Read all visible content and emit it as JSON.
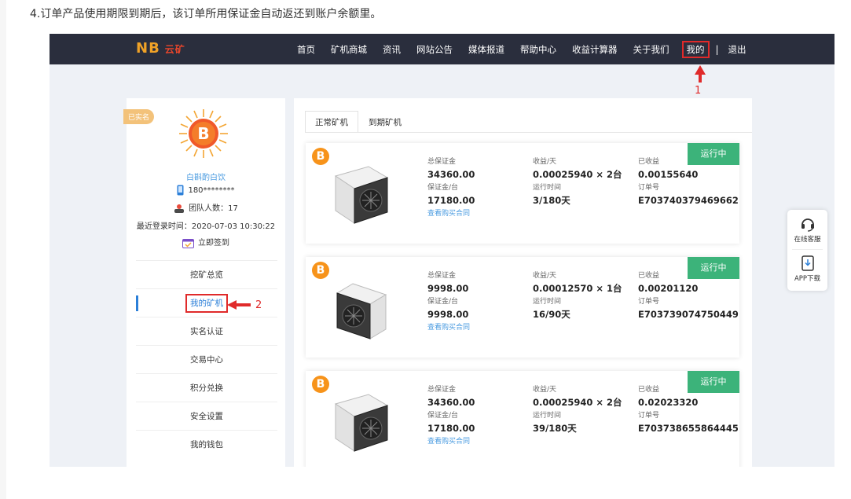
{
  "caption": "4.订单产品使用期限到期后，该订单所用保证金自动返还到账户余额里。",
  "nav": {
    "logo_main": "NB",
    "logo_sub": "云矿",
    "items": [
      "首页",
      "矿机商城",
      "资讯",
      "网站公告",
      "媒体报道",
      "帮助中心",
      "收益计算器",
      "关于我们",
      "我的"
    ],
    "separator": "|",
    "logout": "退出"
  },
  "annotations": {
    "marker1": "1",
    "marker2": "2",
    "arrow_color": "#e02a2a"
  },
  "profile": {
    "badge": "已实名",
    "name": "白斟酌白饮",
    "phone": "180********",
    "team": "团队人数：17",
    "last_login": "最近登录时间：2020-07-03 10:30:22",
    "checkin": "立即签到"
  },
  "menu": [
    "挖矿总览",
    "我的矿机",
    "实名认证",
    "交易中心",
    "积分兑换",
    "安全设置",
    "我的钱包"
  ],
  "menu_active_index": 1,
  "tabs": [
    "正常矿机",
    "到期矿机"
  ],
  "labels": {
    "total_deposit": "总保证金",
    "daily_income": "收益/天",
    "earned": "已收益",
    "deposit_per_unit": "保证金/台",
    "run_time": "运行时间",
    "order_no": "订单号",
    "contract_link": "查看购买合同"
  },
  "orders": [
    {
      "status": "运行中",
      "total_deposit": "34360.00",
      "daily_income": "0.00025940 × 2台",
      "earned": "0.00155640",
      "deposit_per_unit": "17180.00",
      "run_time": "3/180天",
      "order_no": "E703740379469662"
    },
    {
      "status": "运行中",
      "total_deposit": "9998.00",
      "daily_income": "0.00012570 × 1台",
      "earned": "0.00201120",
      "deposit_per_unit": "9998.00",
      "run_time": "16/90天",
      "order_no": "E703739074750449"
    },
    {
      "status": "运行中",
      "total_deposit": "34360.00",
      "daily_income": "0.00025940 × 2台",
      "earned": "0.02023320",
      "deposit_per_unit": "17180.00",
      "run_time": "39/180天",
      "order_no": "E703738655864445"
    }
  ],
  "float_widget": {
    "service": "在线客服",
    "app": "APP下载"
  },
  "colors": {
    "nav_bg": "#2a2e3d",
    "status_green": "#3cb37a",
    "link_blue": "#4a9be0",
    "btc_orange": "#f7931a",
    "highlight_red": "#e02a2a"
  }
}
